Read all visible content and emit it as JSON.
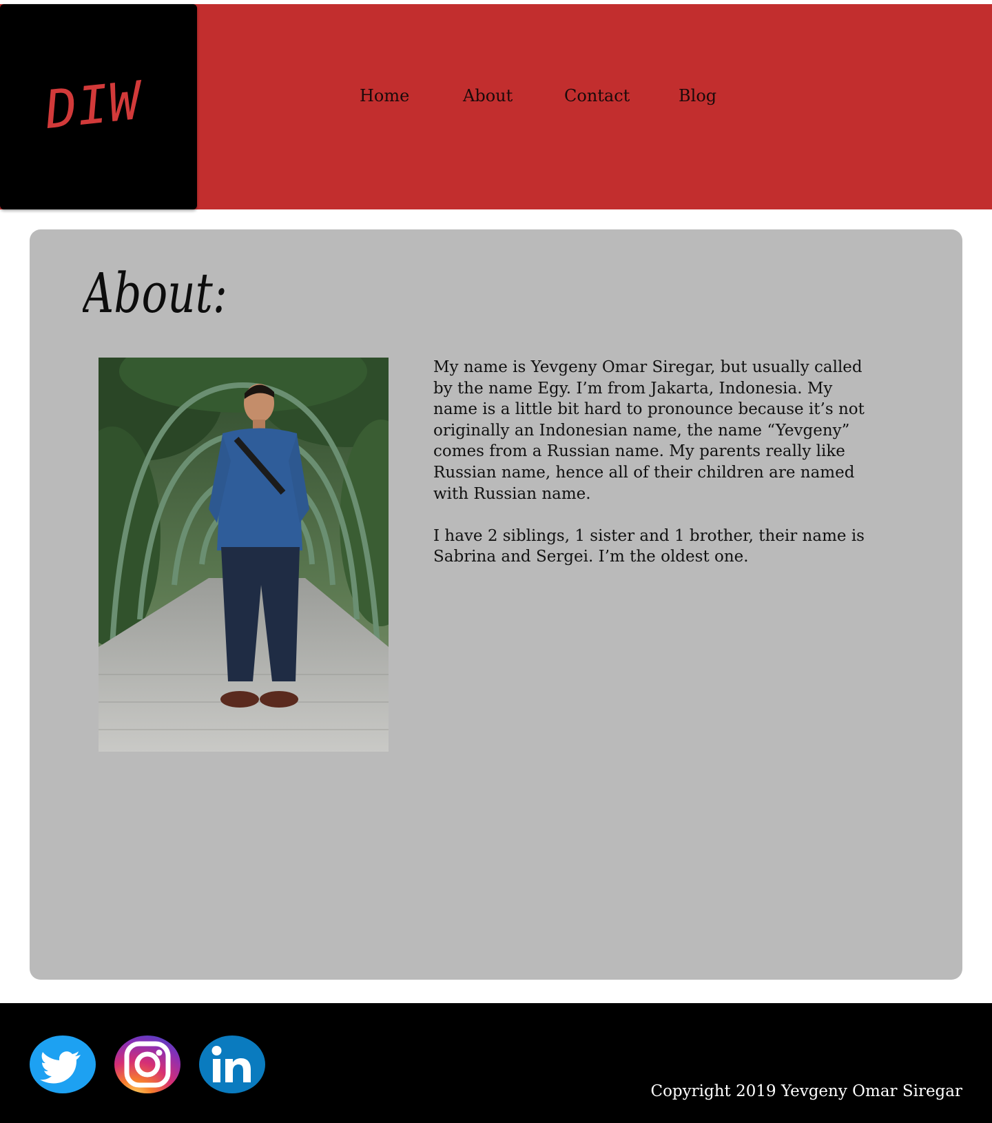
{
  "logo": {
    "text": "DIW"
  },
  "nav": {
    "items": [
      {
        "label": "Home"
      },
      {
        "label": "About"
      },
      {
        "label": "Contact"
      },
      {
        "label": "Blog"
      }
    ]
  },
  "main": {
    "title": "About:",
    "photo_alt": "Photo of Yevgeny Omar Siregar",
    "paragraphs": [
      "My name is Yevgeny Omar Siregar, but usually called by the name Egy. I’m from Jakarta, Indonesia. My name is a little bit hard to pronounce because it’s not originally an Indonesian name, the name “Yevgeny” comes from a Russian name. My parents really like Russian name, hence all of their children are named with Russian name.",
      "I have 2 siblings, 1 sister and 1 brother, their name is Sabrina and Sergei. I’m the oldest one."
    ]
  },
  "footer": {
    "social": [
      {
        "name": "twitter-icon"
      },
      {
        "name": "instagram-icon"
      },
      {
        "name": "linkedin-icon"
      }
    ],
    "copyright": "Copyright 2019 Yevgeny Omar Siregar"
  },
  "colors": {
    "header_red": "#c22e2e",
    "logo_red": "#d23a3a",
    "card_gray": "#bababa",
    "footer_black": "#000000",
    "twitter_blue": "#1da1f2",
    "linkedin_blue": "#0a7bbf"
  }
}
